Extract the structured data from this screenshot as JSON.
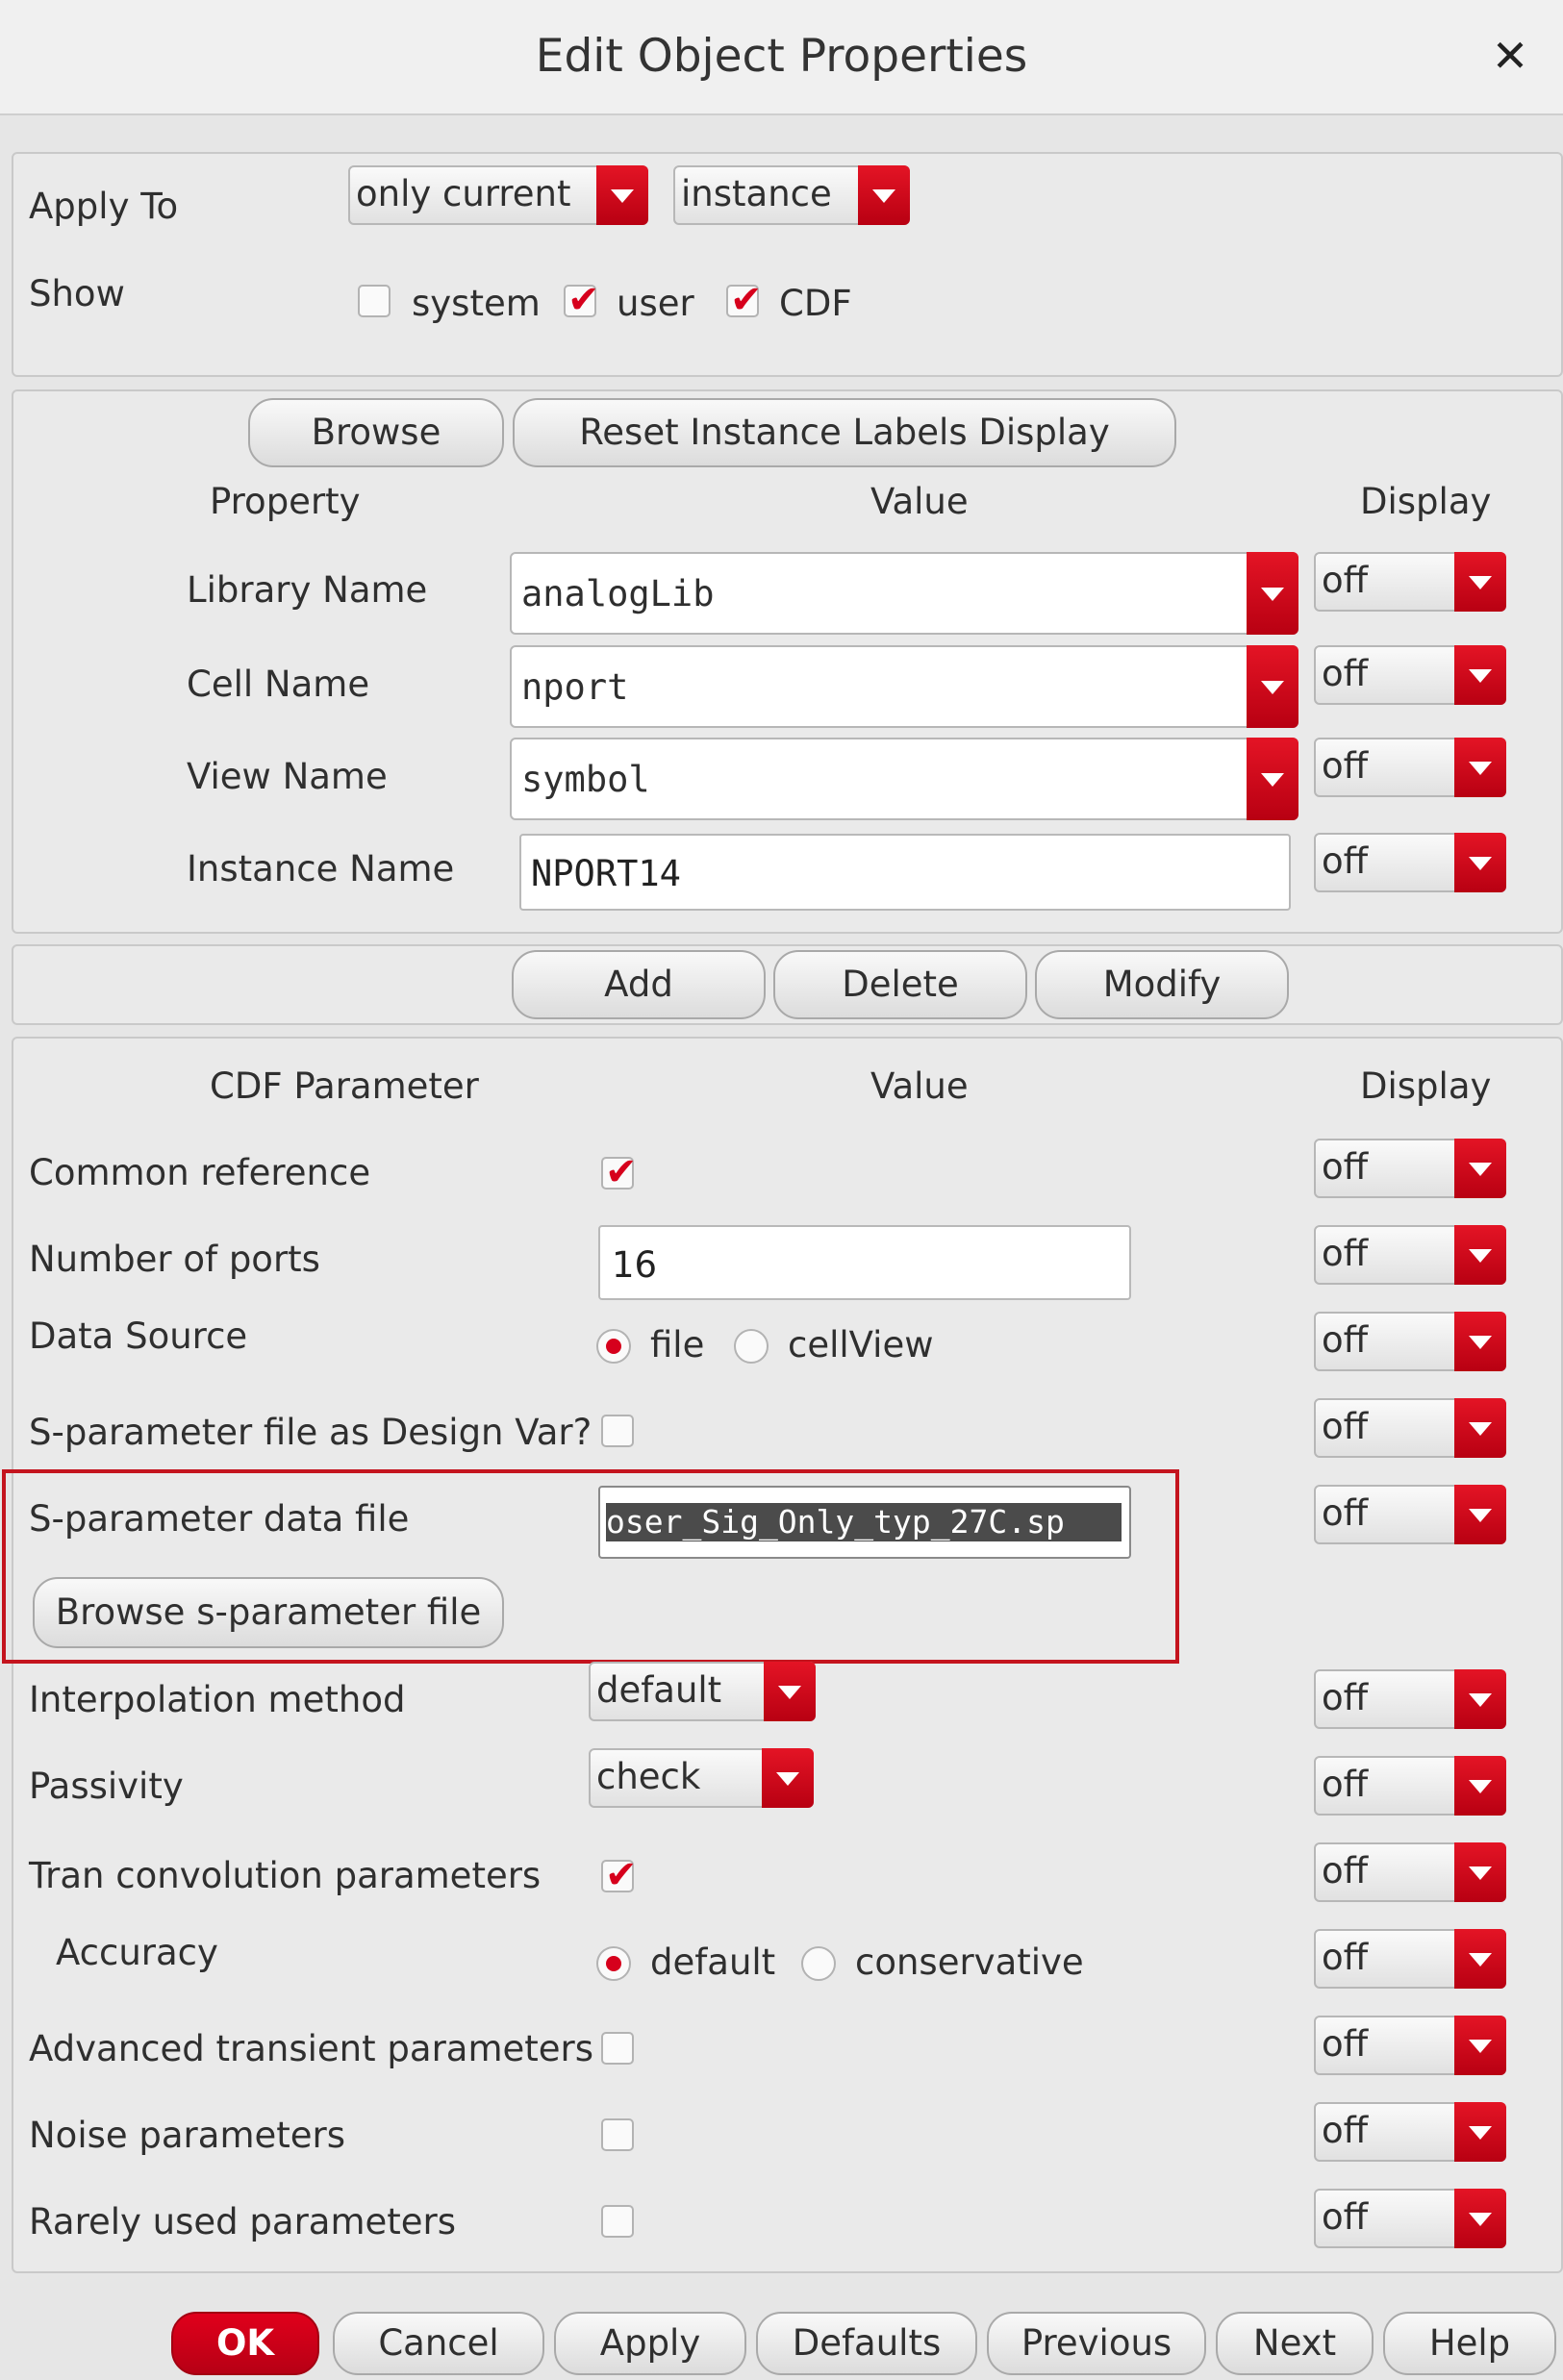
{
  "window": {
    "title": "Edit Object Properties"
  },
  "apply_to": {
    "label": "Apply To",
    "scope": "only current",
    "object": "instance"
  },
  "show": {
    "label": "Show",
    "system": {
      "label": "system",
      "checked": false
    },
    "user": {
      "label": "user",
      "checked": true
    },
    "cdf": {
      "label": "CDF",
      "checked": true
    }
  },
  "buttons_top": {
    "browse": "Browse",
    "reset": "Reset Instance Labels Display"
  },
  "property_headers": {
    "property": "Property",
    "value": "Value",
    "display": "Display"
  },
  "properties": [
    {
      "label": "Library Name",
      "value": "analogLib",
      "display": "off"
    },
    {
      "label": "Cell Name",
      "value": "nport",
      "display": "off"
    },
    {
      "label": "View Name",
      "value": "symbol",
      "display": "off"
    },
    {
      "label": "Instance Name",
      "value": "NPORT14",
      "display": "off"
    }
  ],
  "edit_buttons": {
    "add": "Add",
    "delete": "Delete",
    "modify": "Modify"
  },
  "cdf_headers": {
    "param": "CDF Parameter",
    "value": "Value",
    "display": "Display"
  },
  "cdf": {
    "common_reference": {
      "label": "Common reference",
      "checked": true,
      "display": "off"
    },
    "number_of_ports": {
      "label": "Number of ports",
      "value": "16",
      "display": "off"
    },
    "data_source": {
      "label": "Data Source",
      "opt1": "file",
      "opt2": "cellView",
      "selected": "file",
      "display": "off"
    },
    "sparam_design_var": {
      "label": "S-parameter file as Design Var?",
      "checked": false,
      "display": "off"
    },
    "sparam_data_file": {
      "label": "S-parameter data file",
      "value": "oser_Sig_Only_typ_27C.sp",
      "display": "off"
    },
    "browse_sparam": "Browse s-parameter file",
    "interpolation": {
      "label": "Interpolation method",
      "value": "default",
      "display": "off"
    },
    "passivity": {
      "label": "Passivity",
      "value": "check",
      "display": "off"
    },
    "tran_conv": {
      "label": "Tran convolution parameters",
      "checked": true,
      "display": "off"
    },
    "accuracy": {
      "label": "Accuracy",
      "opt1": "default",
      "opt2": "conservative",
      "selected": "default",
      "display": "off"
    },
    "adv_transient": {
      "label": "Advanced transient parameters",
      "checked": false,
      "display": "off"
    },
    "noise": {
      "label": "Noise parameters",
      "checked": false,
      "display": "off"
    },
    "rarely_used": {
      "label": "Rarely used parameters",
      "checked": false,
      "display": "off"
    }
  },
  "footer": {
    "ok": "OK",
    "cancel": "Cancel",
    "apply": "Apply",
    "defaults": "Defaults",
    "previous": "Previous",
    "next": "Next",
    "help": "Help"
  },
  "colors": {
    "accent": "#d6001c",
    "highlight_box": "#c4141e"
  }
}
